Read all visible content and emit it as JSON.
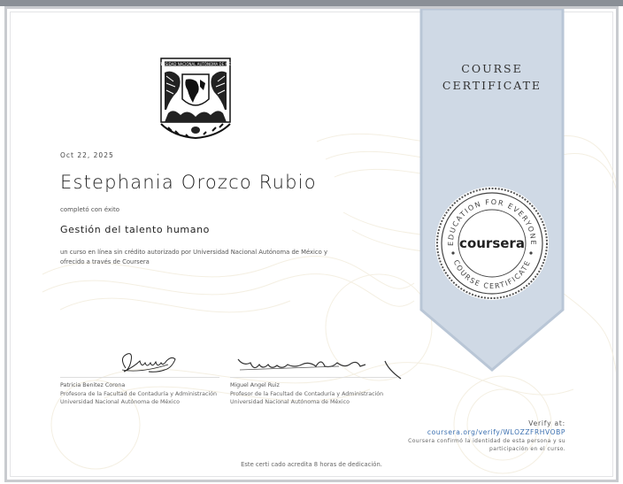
{
  "date": "Oct 22, 2025",
  "recipient": "Estephania Orozco Rubio",
  "completed_label": "completó con éxito",
  "course": "Gestión del talento humano",
  "description_line1": "un curso en línea sin crédito autorizado por Universidad Nacional Autónoma de México y",
  "description_line2": "ofrecido a través de Coursera",
  "ribbon": {
    "line1": "COURSE",
    "line2": "CERTIFICATE"
  },
  "seal": {
    "brand": "coursera",
    "top_text": "EDUCATION FOR EVERYONE",
    "bottom_text": "COURSE CERTIFICATE"
  },
  "university_logo": {
    "top_text": "UNIVERSIDAD NACIONAL AUTÓNOMA DE MÉXICO",
    "side_text": "POR MI RAZA HABLARÁ EL ESPÍRITU",
    "icon": "unam-seal-icon"
  },
  "signatories": [
    {
      "name": "Patricia Benitez Corona",
      "title": "Profesora de la Facultad de Contaduría y Administración",
      "org": "Universidad Nacional Autónoma de México"
    },
    {
      "name": "Miguel Angel Ruiz",
      "title": "Profesor de la Facultad de Contaduría y Administración",
      "org": "Universidad Nacional Autónoma de México"
    }
  ],
  "verify": {
    "label": "Verify at:",
    "url": "coursera.org/verify/WLOZZFRHVOBP",
    "note_line1": "Coursera confirmó la identidad de esta persona y su",
    "note_line2": "participación en el curso."
  },
  "hours": "Este certi cado acredita 8 horas de dedicación.",
  "colors": {
    "ribbon": "#cfd9e5",
    "ribbon_edge": "#b9c6d6",
    "link": "#3a6fb0",
    "frame": "#c9cbcf"
  }
}
